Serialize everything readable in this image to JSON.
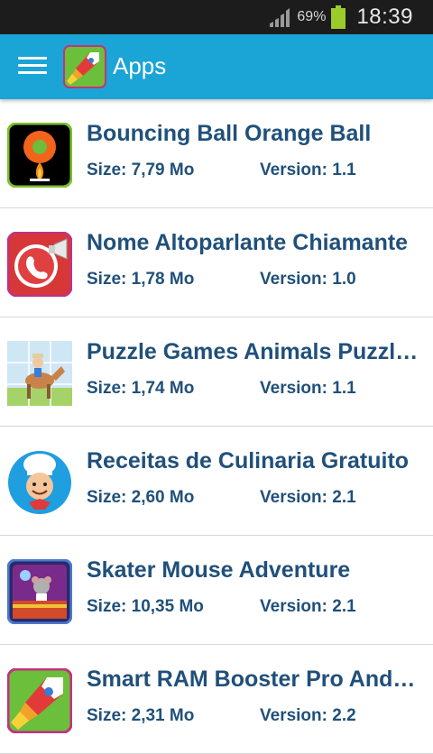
{
  "status_bar": {
    "battery_percent": "69%",
    "time": "18:39",
    "battery_color": "#9ccc29"
  },
  "app_bar": {
    "title": "Apps",
    "menu_icon": "hamburger-menu-icon",
    "logo_icon": "rocket-logo-icon",
    "background": "#1ba4d6"
  },
  "apps": [
    {
      "name": "Bouncing Ball Orange Ball",
      "size": "Size: 7,79 Mo",
      "version": "Version: 1.1",
      "icon": "orange-ball-icon"
    },
    {
      "name": "Nome Altoparlante Chiamante",
      "size": "Size: 1,78 Mo",
      "version": "Version: 1.0",
      "icon": "phone-speaker-icon"
    },
    {
      "name": "Puzzle Games Animals Puzzl…",
      "size": "Size: 1,74 Mo",
      "version": "Version: 1.1",
      "icon": "puzzle-animal-icon"
    },
    {
      "name": "Receitas de Culinaria Gratuito",
      "size": "Size: 2,60 Mo",
      "version": "Version: 2.1",
      "icon": "chef-icon"
    },
    {
      "name": "Skater Mouse Adventure",
      "size": "Size: 10,35 Mo",
      "version": "Version: 2.1",
      "icon": "skater-mouse-icon"
    },
    {
      "name": "Smart RAM Booster Pro Andr…",
      "size": "Size: 2,31 Mo",
      "version": "Version: 2.2",
      "icon": "rocket-icon"
    }
  ],
  "text_color": "#20507a"
}
